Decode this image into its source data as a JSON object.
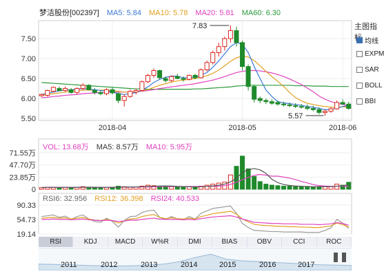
{
  "header": {
    "stock": "梦洁股份[002397]",
    "ma5_label": "MA5: 5.84",
    "ma10_label": "MA10: 5.78",
    "ma20_label": "MA20: 5.81",
    "ma60_label": "MA60: 6.30"
  },
  "colors": {
    "up": "#d9241b",
    "down": "#1f8a2b",
    "ma5": "#3a78d6",
    "ma10": "#e0a020",
    "ma20": "#e040c0",
    "ma60": "#2a9a3a",
    "rsi6": "#999999",
    "rsi12": "#e0a020",
    "rsi24": "#e040c0"
  },
  "side_panel": {
    "title": "主图指标",
    "options": [
      {
        "label": "均线",
        "checked": true
      },
      {
        "label": "EXPMA",
        "checked": false
      },
      {
        "label": "SAR",
        "checked": false
      },
      {
        "label": "BOLL",
        "checked": false
      },
      {
        "label": "BBI",
        "checked": false
      }
    ]
  },
  "chart_data": [
    {
      "type": "candlestick",
      "ylim": [
        5.45,
        7.95
      ],
      "yticks": [
        5.5,
        6.0,
        6.5,
        7.0,
        7.5
      ],
      "xticks": [
        "2018-04",
        "2018-05",
        "2018-06"
      ],
      "annotations": [
        {
          "label": "7.83",
          "value": 7.83
        },
        {
          "label": "5.57",
          "value": 5.57
        }
      ],
      "candles": [
        [
          6.07,
          6.12,
          6.04,
          6.1
        ],
        [
          6.08,
          6.22,
          6.05,
          6.2
        ],
        [
          6.18,
          6.3,
          6.15,
          6.28
        ],
        [
          6.25,
          6.3,
          6.18,
          6.2
        ],
        [
          6.2,
          6.3,
          6.16,
          6.25
        ],
        [
          6.22,
          6.26,
          6.12,
          6.15
        ],
        [
          6.15,
          6.28,
          6.1,
          6.25
        ],
        [
          6.25,
          6.38,
          6.2,
          6.33
        ],
        [
          6.33,
          6.36,
          6.2,
          6.22
        ],
        [
          6.2,
          6.26,
          6.1,
          6.15
        ],
        [
          6.15,
          6.2,
          6.08,
          6.12
        ],
        [
          6.12,
          6.26,
          6.08,
          6.22
        ],
        [
          6.22,
          6.28,
          6.1,
          6.14
        ],
        [
          6.12,
          6.16,
          5.88,
          5.95
        ],
        [
          5.95,
          6.1,
          5.8,
          6.05
        ],
        [
          6.05,
          6.22,
          6.02,
          6.18
        ],
        [
          6.16,
          6.25,
          6.1,
          6.2
        ],
        [
          6.2,
          6.45,
          6.18,
          6.42
        ],
        [
          6.42,
          6.62,
          6.38,
          6.58
        ],
        [
          6.58,
          6.75,
          6.52,
          6.7
        ],
        [
          6.7,
          6.72,
          6.48,
          6.52
        ],
        [
          6.5,
          6.55,
          6.4,
          6.45
        ],
        [
          6.45,
          6.58,
          6.4,
          6.55
        ],
        [
          6.55,
          6.62,
          6.48,
          6.5
        ],
        [
          6.5,
          6.55,
          6.42,
          6.48
        ],
        [
          6.48,
          6.6,
          6.45,
          6.58
        ],
        [
          6.58,
          6.62,
          6.48,
          6.52
        ],
        [
          6.52,
          6.75,
          6.5,
          6.72
        ],
        [
          6.72,
          6.95,
          6.68,
          6.9
        ],
        [
          6.9,
          7.2,
          6.85,
          7.15
        ],
        [
          7.15,
          7.4,
          7.05,
          7.3
        ],
        [
          7.3,
          7.55,
          7.2,
          7.5
        ],
        [
          7.5,
          7.83,
          7.4,
          7.7
        ],
        [
          7.7,
          7.8,
          7.3,
          7.4
        ],
        [
          7.4,
          7.45,
          6.7,
          6.8
        ],
        [
          6.8,
          6.85,
          6.2,
          6.3
        ],
        [
          6.3,
          6.35,
          5.9,
          5.98
        ],
        [
          6.0,
          6.05,
          5.88,
          5.95
        ],
        [
          5.95,
          6.0,
          5.86,
          5.92
        ],
        [
          5.92,
          5.98,
          5.84,
          5.88
        ],
        [
          5.9,
          5.95,
          5.82,
          5.86
        ],
        [
          5.86,
          5.92,
          5.8,
          5.84
        ],
        [
          5.84,
          5.9,
          5.78,
          5.82
        ],
        [
          5.82,
          5.88,
          5.76,
          5.8
        ],
        [
          5.8,
          5.86,
          5.74,
          5.78
        ],
        [
          5.78,
          5.85,
          5.7,
          5.75
        ],
        [
          5.75,
          5.82,
          5.68,
          5.72
        ],
        [
          5.72,
          5.78,
          5.6,
          5.65
        ],
        [
          5.65,
          5.72,
          5.57,
          5.68
        ],
        [
          5.68,
          5.78,
          5.64,
          5.74
        ],
        [
          5.74,
          5.95,
          5.72,
          5.9
        ],
        [
          5.9,
          5.98,
          5.84,
          5.86
        ],
        [
          5.86,
          5.92,
          5.72,
          5.75
        ]
      ],
      "ma5": [
        6.1,
        6.13,
        6.16,
        6.19,
        6.21,
        6.22,
        6.23,
        6.25,
        6.23,
        6.22,
        6.2,
        6.19,
        6.17,
        6.12,
        6.1,
        6.12,
        6.15,
        6.21,
        6.29,
        6.4,
        6.48,
        6.53,
        6.56,
        6.56,
        6.52,
        6.52,
        6.53,
        6.58,
        6.65,
        6.78,
        6.94,
        7.12,
        7.3,
        7.4,
        7.36,
        7.15,
        6.8,
        6.5,
        6.21,
        6.05,
        5.92,
        5.89,
        5.87,
        5.85,
        5.83,
        5.8,
        5.78,
        5.75,
        5.72,
        5.72,
        5.76,
        5.8,
        5.82
      ],
      "ma10": [
        6.08,
        6.1,
        6.12,
        6.14,
        6.16,
        6.18,
        6.19,
        6.21,
        6.21,
        6.21,
        6.21,
        6.21,
        6.2,
        6.18,
        6.16,
        6.16,
        6.17,
        6.19,
        6.22,
        6.28,
        6.33,
        6.37,
        6.41,
        6.44,
        6.46,
        6.48,
        6.5,
        6.53,
        6.57,
        6.63,
        6.71,
        6.82,
        6.93,
        7.02,
        7.06,
        7.04,
        6.95,
        6.82,
        6.68,
        6.55,
        6.43,
        6.3,
        6.15,
        6.02,
        5.94,
        5.88,
        5.85,
        5.82,
        5.8,
        5.78,
        5.78,
        5.79,
        5.78
      ],
      "ma20": [
        6.02,
        6.03,
        6.05,
        6.06,
        6.08,
        6.09,
        6.1,
        6.12,
        6.13,
        6.14,
        6.15,
        6.15,
        6.16,
        6.16,
        6.16,
        6.16,
        6.17,
        6.18,
        6.2,
        6.22,
        6.25,
        6.27,
        6.29,
        6.31,
        6.33,
        6.35,
        6.37,
        6.4,
        6.43,
        6.46,
        6.5,
        6.55,
        6.6,
        6.65,
        6.68,
        6.7,
        6.7,
        6.69,
        6.67,
        6.64,
        6.6,
        6.55,
        6.49,
        6.42,
        6.35,
        6.26,
        6.17,
        6.06,
        5.98,
        5.92,
        5.88,
        5.85,
        5.81
      ],
      "ma60": [
        6.4,
        6.39,
        6.38,
        6.37,
        6.36,
        6.35,
        6.34,
        6.33,
        6.32,
        6.31,
        6.3,
        6.29,
        6.28,
        6.27,
        6.26,
        6.25,
        6.24,
        6.24,
        6.23,
        6.23,
        6.23,
        6.23,
        6.23,
        6.23,
        6.23,
        6.23,
        6.24,
        6.24,
        6.25,
        6.26,
        6.27,
        6.28,
        6.29,
        6.31,
        6.32,
        6.33,
        6.33,
        6.33,
        6.33,
        6.33,
        6.33,
        6.33,
        6.33,
        6.32,
        6.32,
        6.32,
        6.31,
        6.31,
        6.31,
        6.3,
        6.3,
        6.3,
        6.3
      ]
    },
    {
      "type": "bar",
      "legend": {
        "vol": "VOL: 13.68万",
        "ma5": "MA5: 8.57万",
        "ma10": "MA10: 5.95万"
      },
      "ylim": [
        0,
        71.55
      ],
      "yticks_labels": [
        "71.55万",
        "47.70万",
        "23.85万",
        "0"
      ],
      "yticks": [
        71.55,
        47.7,
        23.85,
        0
      ],
      "volumes": [
        3,
        4,
        4,
        3,
        4,
        3,
        4,
        5,
        4,
        3,
        3,
        4,
        3,
        6,
        5,
        4,
        4,
        6,
        8,
        7,
        6,
        5,
        5,
        4,
        4,
        5,
        4,
        6,
        8,
        10,
        12,
        14,
        28,
        45,
        65,
        40,
        25,
        15,
        10,
        8,
        7,
        6,
        6,
        5,
        5,
        5,
        4,
        5,
        6,
        5,
        10,
        8,
        13.68
      ],
      "vol_ma5": [
        3.5,
        3.6,
        3.7,
        3.8,
        3.8,
        3.8,
        3.9,
        4.0,
        4.0,
        3.9,
        3.8,
        3.8,
        3.7,
        4.2,
        4.4,
        4.4,
        4.5,
        5.0,
        5.4,
        5.8,
        6.2,
        6.4,
        6.2,
        5.6,
        5.2,
        4.8,
        4.6,
        4.8,
        5.4,
        6.6,
        8.0,
        10.0,
        14.4,
        21.8,
        32.8,
        38.4,
        40.6,
        38.0,
        31.0,
        19.6,
        13.0,
        9.2,
        7.4,
        6.4,
        5.8,
        5.4,
        5.0,
        5.0,
        5.2,
        5.0,
        6.0,
        6.8,
        8.57
      ],
      "vol_ma10": [
        3.4,
        3.5,
        3.5,
        3.6,
        3.6,
        3.7,
        3.7,
        3.8,
        3.8,
        3.8,
        3.8,
        3.8,
        3.8,
        4.0,
        4.1,
        4.1,
        4.2,
        4.4,
        4.6,
        4.9,
        5.2,
        5.4,
        5.4,
        5.3,
        5.3,
        5.4,
        5.4,
        5.5,
        5.5,
        5.7,
        6.1,
        7.0,
        9.6,
        13.6,
        18.8,
        23.2,
        27.2,
        29.0,
        27.6,
        25.6,
        25.7,
        23.8,
        21.9,
        18.8,
        15.3,
        12.4,
        9.0,
        7.1,
        6.2,
        5.6,
        5.9,
        5.8,
        5.95
      ]
    },
    {
      "type": "line",
      "legend": {
        "rsi6": "RSI6: 32.956",
        "rsi12": "RSI12: 36.398",
        "rsi24": "RSI24: 40.533"
      },
      "ylim": [
        19.14,
        90.33
      ],
      "yticks": [
        90.33,
        54.73,
        19.14
      ],
      "rsi6": [
        62,
        64,
        66,
        60,
        63,
        55,
        62,
        66,
        56,
        50,
        48,
        58,
        50,
        36,
        52,
        62,
        63,
        72,
        76,
        78,
        60,
        55,
        62,
        56,
        54,
        62,
        56,
        70,
        76,
        82,
        84,
        86,
        88,
        70,
        45,
        35,
        28,
        27,
        26,
        25,
        25,
        24,
        24,
        24,
        24,
        23,
        23,
        23,
        28,
        34,
        55,
        46,
        32.956
      ],
      "rsi12": [
        58,
        59,
        60,
        58,
        59,
        56,
        58,
        60,
        56,
        53,
        52,
        55,
        52,
        46,
        51,
        56,
        57,
        62,
        65,
        67,
        60,
        57,
        59,
        57,
        56,
        58,
        56,
        62,
        65,
        69,
        71,
        73,
        75,
        68,
        56,
        49,
        43,
        41,
        40,
        39,
        38,
        38,
        37,
        37,
        36,
        36,
        35,
        35,
        37,
        39,
        46,
        42,
        36.398
      ],
      "rsi24": [
        55,
        55,
        56,
        55,
        55,
        54,
        55,
        56,
        54,
        53,
        52,
        53,
        52,
        50,
        51,
        53,
        53,
        55,
        57,
        58,
        56,
        55,
        55,
        55,
        54,
        55,
        54,
        57,
        59,
        61,
        62,
        63,
        64,
        61,
        56,
        52,
        48,
        47,
        46,
        45,
        45,
        44,
        44,
        44,
        43,
        43,
        43,
        42,
        43,
        44,
        47,
        45,
        40.533
      ]
    }
  ],
  "indicator_tabs": [
    "RSI",
    "KDJ",
    "MACD",
    "W%R",
    "DMI",
    "BIAS",
    "OBV",
    "CCI",
    "ROC"
  ],
  "active_tab": "RSI",
  "navigator": {
    "years": [
      "2011",
      "2012",
      "2013",
      "2014",
      "2015",
      "2016",
      "2017"
    ],
    "history": [
      0.3,
      0.28,
      0.26,
      0.22,
      0.2,
      0.18,
      0.2,
      0.24,
      0.3,
      0.45,
      0.7,
      0.9,
      0.6,
      0.5,
      0.46,
      0.4,
      0.36,
      0.3,
      0.26,
      0.24,
      0.22
    ]
  }
}
